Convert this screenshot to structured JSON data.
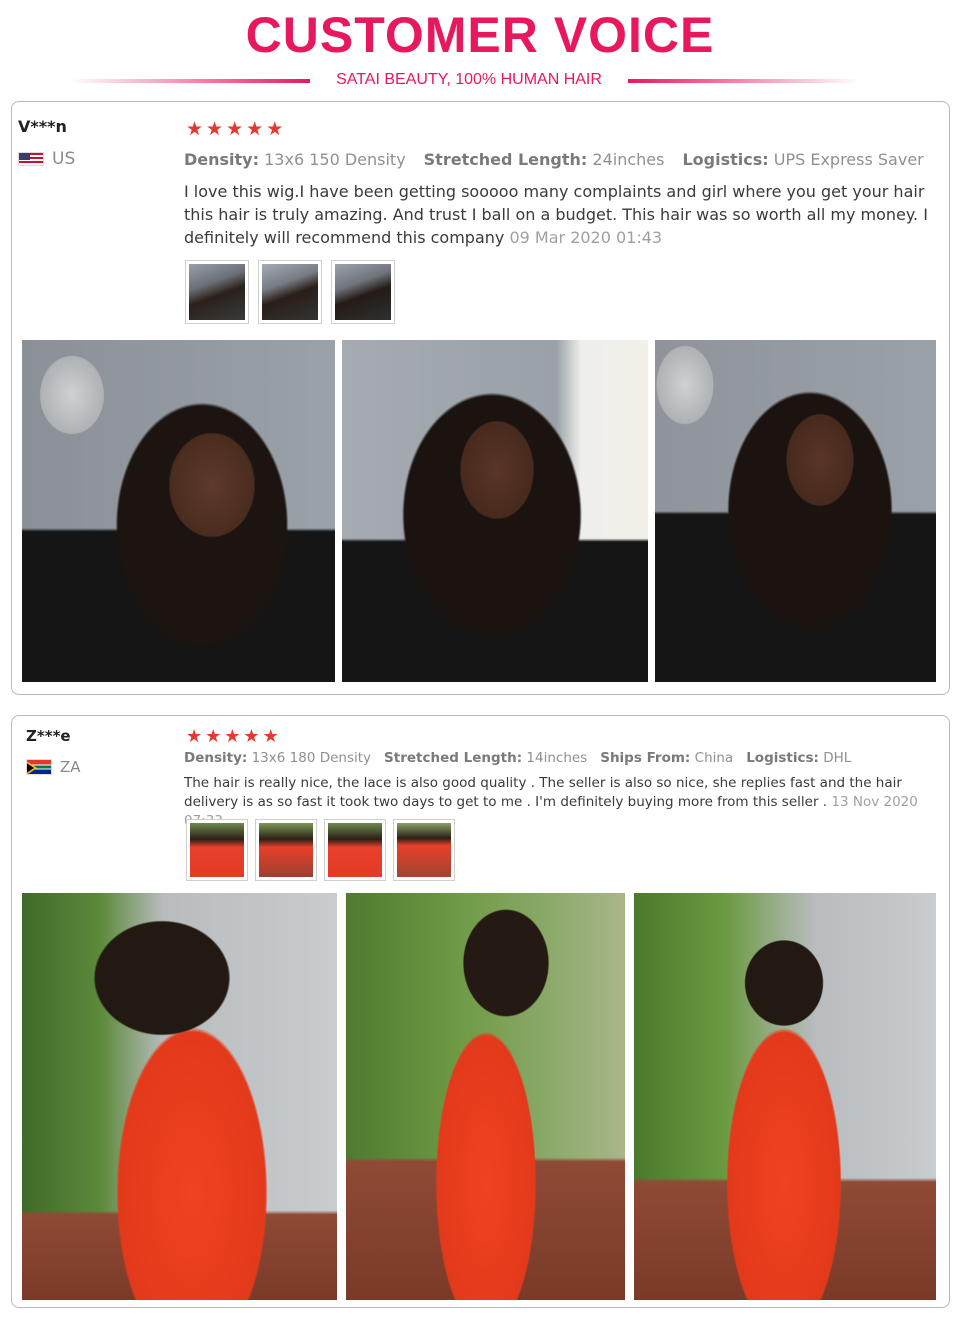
{
  "header": {
    "title": "CUSTOMER VOICE",
    "subtitle": "SATAI BEAUTY, 100% HUMAN HAIR"
  },
  "reviews": [
    {
      "user": "V***n",
      "country": "US",
      "rating": 5,
      "density_label": "Density:",
      "density": "13x6 150 Density",
      "length_label": "Stretched Length:",
      "length": "24inches",
      "logistics_label": "Logistics:",
      "logistics": "UPS Express Saver",
      "text": "I love this wig.I have been getting sooooo many complaints and girl where you get your hair this hair is truly amazing. And trust I ball on a budget. This hair was so worth all my money. I definitely will recommend this company",
      "date": "09 Mar 2020 01:43",
      "thumbnail_count": 3,
      "photo_count": 3
    },
    {
      "user": "Z***e",
      "country": "ZA",
      "rating": 5,
      "density_label": "Density:",
      "density": "13x6 180 Density",
      "length_label": "Stretched Length:",
      "length": "14inches",
      "ships_label": "Ships From:",
      "ships_from": "China",
      "logistics_label": "Logistics:",
      "logistics": "DHL",
      "text": "The hair is really nice, the lace is also good quality . The seller is also so nice, she replies fast and the hair delivery is as so fast it took two days to get to me . I'm definitely buying more from this seller .",
      "date": "13 Nov 2020 07:33",
      "thumbnail_count": 4,
      "photo_count": 3
    }
  ],
  "colors": {
    "accent": "#e8185e",
    "star": "#e6392e",
    "border": "#b9b9b9"
  }
}
